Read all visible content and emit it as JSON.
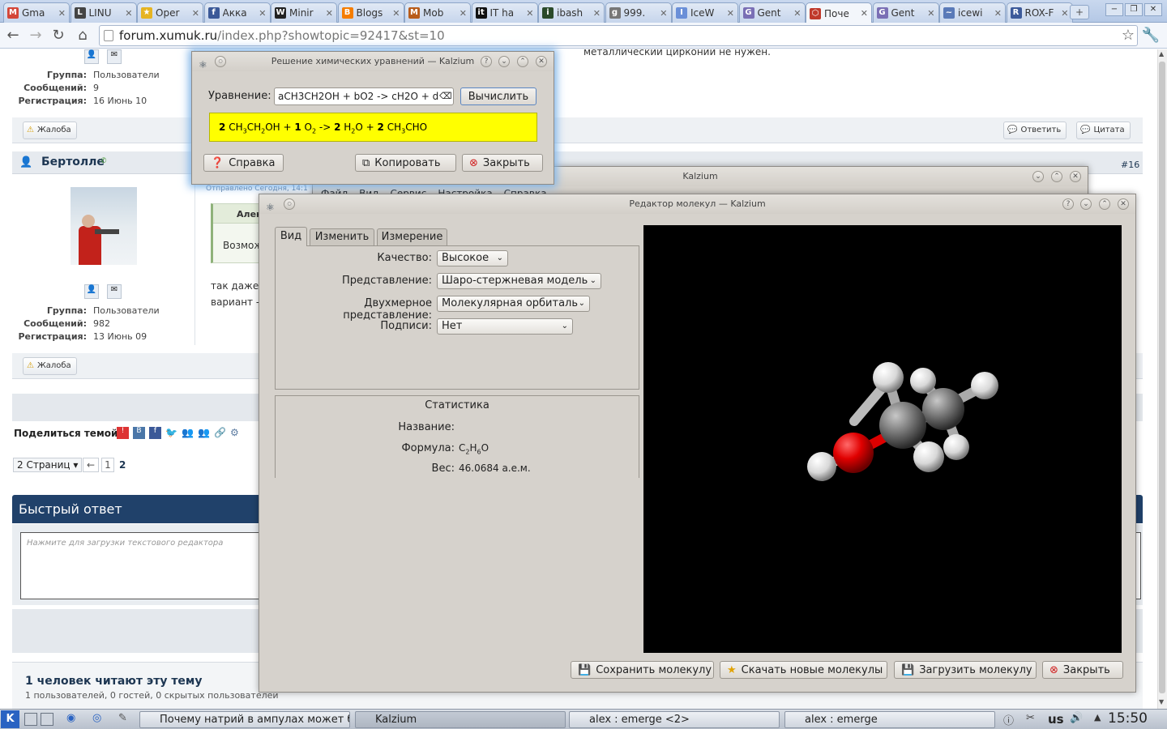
{
  "browser": {
    "tabs": [
      {
        "label": "Gma",
        "color": "#d44638",
        "glyph": "M"
      },
      {
        "label": "LINU",
        "color": "#444444",
        "glyph": "L"
      },
      {
        "label": "Oper",
        "color": "#e6b422",
        "glyph": "★"
      },
      {
        "label": "Акка",
        "color": "#3b5998",
        "glyph": "f"
      },
      {
        "label": "Minir",
        "color": "#222222",
        "glyph": "W"
      },
      {
        "label": "Blogs",
        "color": "#f57d00",
        "glyph": "B"
      },
      {
        "label": "Mob",
        "color": "#b85c1a",
        "glyph": "M"
      },
      {
        "label": "IT ha",
        "color": "#111111",
        "glyph": "it"
      },
      {
        "label": "ibash",
        "color": "#2a4a2a",
        "glyph": "i"
      },
      {
        "label": "999.",
        "color": "#777777",
        "glyph": "g"
      },
      {
        "label": "IceW",
        "color": "#6a8fd8",
        "glyph": "I"
      },
      {
        "label": "Gent",
        "color": "#7a6fb5",
        "glyph": "G"
      },
      {
        "label": "Поче",
        "color": "#c0392b",
        "glyph": "⬡"
      },
      {
        "label": "Gent",
        "color": "#7a6fb5",
        "glyph": "G"
      },
      {
        "label": "icewi",
        "color": "#5a7ab8",
        "glyph": "~"
      },
      {
        "label": "ROX-F",
        "color": "#3c5a9a",
        "glyph": "R"
      }
    ],
    "active_tab": 12,
    "url_host": "forum.xumuk.ru",
    "url_path": "/index.php?showtopic=92417&st=10"
  },
  "forum": {
    "top_text": "металлический цирконий не нужен.",
    "post1": {
      "group_label": "Группа:",
      "group": "Пользователи",
      "posts_label": "Сообщений:",
      "posts": "9",
      "reg_label": "Регистрация:",
      "reg": "16 Июнь 10"
    },
    "complaint": "Жалоба",
    "reply": "Ответить",
    "quote": "Цитата",
    "post2": {
      "author": "Бертолле",
      "num": "#16",
      "sent": "Отправлено Сегодня, 14:1",
      "quote_author": "Алек",
      "quote_text": "Возмож",
      "body1": "так даже у",
      "body2": "вариант -",
      "group_label": "Группа:",
      "group": "Пользователи",
      "posts_label": "Сообщений:",
      "posts": "982",
      "reg_label": "Регистрация:",
      "reg": "13 Июнь 09"
    },
    "share_label": "Поделиться темой:",
    "pages_btn": "2 Страниц",
    "prev": "←",
    "page1": "1",
    "page2": "2",
    "quick_reply": "Быстрый ответ",
    "editor_placeholder": "Нажмите для загрузки текстового редактора",
    "readers_title": "1 человек читают эту тему",
    "readers_sub": "1 пользователей, 0 гостей, 0 скрытых пользователей"
  },
  "equation_dialog": {
    "title": "Решение химических уравнений — Kalzium",
    "label": "Уравнение:",
    "input": "aCH3CH2OH + bO2 -> cH2O + d",
    "compute": "Вычислить",
    "help": "Справка",
    "copy": "Копировать",
    "close": "Закрыть",
    "result": {
      "c1": "2",
      "t1": "CH",
      "s1": "3",
      "t2": "CH",
      "s2": "2",
      "t3": "OH + ",
      "c2": "1",
      "t4": " O",
      "s3": "2",
      "t5": " -> ",
      "c3": "2",
      "t6": " H",
      "s4": "2",
      "t7": "O + ",
      "c4": "2",
      "t8": " CH",
      "s5": "3",
      "t9": "CHO"
    }
  },
  "kalzium_main": {
    "title": "Kalzium",
    "menu": [
      "Файл",
      "Вид",
      "Сервис",
      "Настройка",
      "Справка"
    ]
  },
  "mol_editor": {
    "title": "Редактор молекул — Kalzium",
    "tabs": [
      "Вид",
      "Изменить",
      "Измерение"
    ],
    "quality_label": "Качество:",
    "quality": "Высокое",
    "repr_label": "Представление:",
    "repr": "Шаро-стержневая модель",
    "repr2d_label": "Двухмерное представление:",
    "repr2d": "Молекулярная орбиталь",
    "labels_label": "Подписи:",
    "labels": "Нет",
    "stats_title": "Статистика",
    "name_label": "Название:",
    "formula_label": "Формула:",
    "formula": {
      "a": "C",
      "b": "2",
      "c": "H",
      "d": "6",
      "e": "O"
    },
    "weight_label": "Вес:",
    "weight": "46.0684 а.е.м.",
    "save": "Сохранить молекулу",
    "download": "Скачать новые молекулы",
    "load": "Загрузить молекулу",
    "close": "Закрыть"
  },
  "taskbar": {
    "items": [
      "Почему натрий в ампулах может б",
      "Kalzium",
      "alex : emerge <2>",
      "alex : emerge"
    ],
    "layout": "us",
    "clock": "15:50"
  }
}
